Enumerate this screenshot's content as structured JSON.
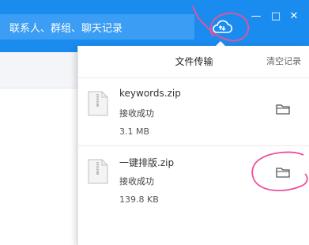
{
  "header": {
    "search_placeholder": "联系人、群组、聊天记录",
    "cloud_icon": "cloud-upload-icon",
    "window_controls": {
      "minimize": "—",
      "maximize": "□",
      "close": "✕"
    }
  },
  "panel": {
    "title": "文件传输",
    "clear_label": "清空记录",
    "files": [
      {
        "name": "keywords.zip",
        "status": "接收成功",
        "size": "3.1 MB"
      },
      {
        "name": "一键排版.zip",
        "status": "接收成功",
        "size": "139.8 KB"
      }
    ]
  },
  "colors": {
    "header_blue": "#1a8cf0",
    "annotation_pink": "#ee4f9a"
  }
}
